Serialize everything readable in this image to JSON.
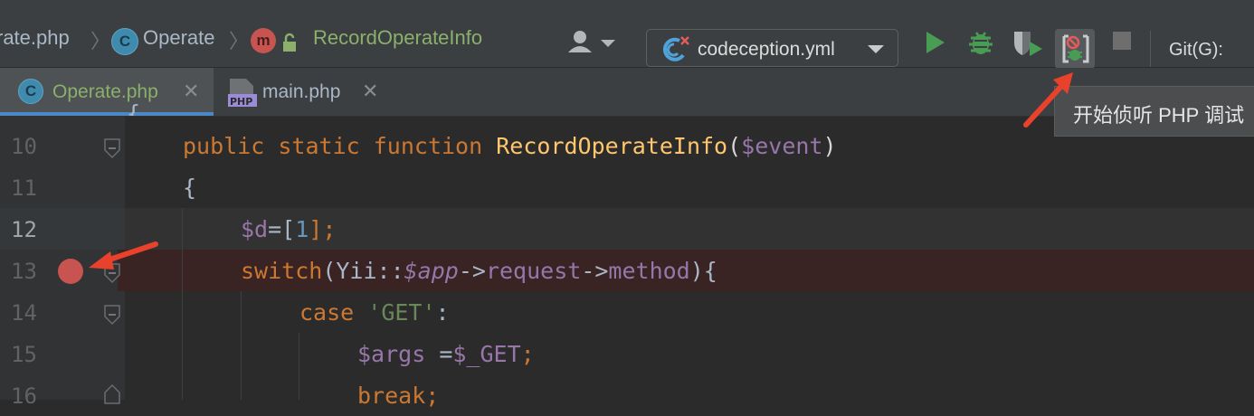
{
  "breadcrumb": {
    "file": "rate.php",
    "class": "Operate",
    "method": "RecordOperateInfo"
  },
  "toolbar": {
    "run_config": "codeception.yml",
    "git_label": "Git(G):"
  },
  "tabs": [
    {
      "label": "Operate.php",
      "icon": "class-icon",
      "active": true
    },
    {
      "label": "main.php",
      "icon": "php-file-icon",
      "active": false
    }
  ],
  "tooltip": "开始侦听 PHP 调试",
  "editor": {
    "line_numbers": [
      "10",
      "11",
      "12",
      "13",
      "14",
      "15",
      "16"
    ],
    "lines": {
      "l10": {
        "kw1": "public",
        "kw2": "static",
        "kw3": "function",
        "fn": "RecordOperateInfo",
        "p1": "(",
        "var": "$event",
        "p2": ")"
      },
      "l11": {
        "text": "{"
      },
      "l12": {
        "var": "$d",
        "eq": "=[",
        "num": "1",
        "end": "];"
      },
      "l13": {
        "kw": "switch",
        "p1": "(Yii::",
        "ivar": "$app",
        "a1": "->",
        "m1": "request",
        "a2": "->",
        "m2": "method",
        "end": "){"
      },
      "l14": {
        "kw": "case",
        "str": "'GET'",
        "end": ":"
      },
      "l15": {
        "var": "$args",
        "eq": " =",
        "var2": "$_GET",
        "end": ";"
      },
      "l16": {
        "kw": "break",
        "end": ";"
      }
    }
  },
  "colors": {
    "breakpoint": "#c75450",
    "arrow": "#e8412c",
    "keyword": "#cc7832",
    "function": "#ffc66d",
    "variable": "#9876aa"
  }
}
